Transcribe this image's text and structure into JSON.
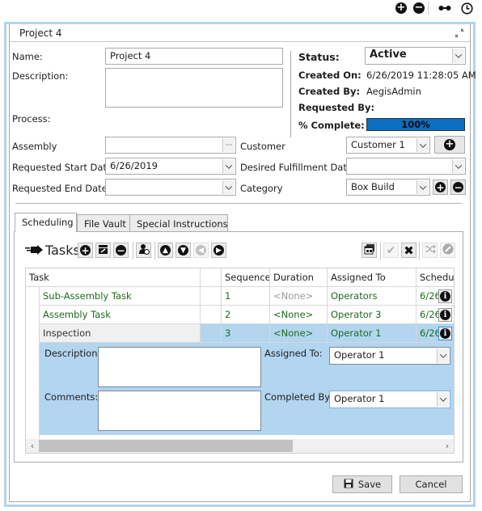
{
  "top_toolbar": {
    "icons": [
      "add-icon",
      "remove-icon",
      "link-icon",
      "clock-icon"
    ]
  },
  "window": {
    "title": "Project 4"
  },
  "form": {
    "name_label": "Name:",
    "name_value": "Project 4",
    "description_label": "Description:",
    "description_value": "",
    "process_label": "Process:",
    "assembly_label": "Assembly",
    "assembly_value": "",
    "requested_start_label": "Requested Start Date",
    "requested_start_value": "6/26/2019",
    "requested_end_label": "Requested End Date",
    "requested_end_value": "",
    "customer_label": "Customer",
    "customer_value": "Customer 1",
    "desired_fulfillment_label": "Desired Fulfillment Date",
    "desired_fulfillment_value": "",
    "category_label": "Category",
    "category_value": "Box Build"
  },
  "status_panel": {
    "status_label": "Status:",
    "status_value": "Active",
    "created_on_label": "Created On:",
    "created_on_value": "6/26/2019 11:28:05 AM",
    "created_by_label": "Created By:",
    "created_by_value": "AegisAdmin",
    "requested_by_label": "Requested By:",
    "requested_by_value": "",
    "percent_complete_label": "% Complete:",
    "percent_complete_value": 100,
    "percent_complete_text": "100%",
    "progress_color": "#0a6fc2"
  },
  "tabs": [
    {
      "label": "Scheduling",
      "active": true
    },
    {
      "label": "File Vault",
      "active": false
    },
    {
      "label": "Special Instructions",
      "active": false
    }
  ],
  "tasks_toolbar": {
    "title": "Tasks"
  },
  "grid": {
    "columns": [
      "Task",
      "",
      "Sequence",
      "Duration",
      "Assigned To",
      "Schedul"
    ],
    "rows": [
      {
        "task": "Sub-Assembly Task",
        "sequence": "1",
        "duration": "<None>",
        "assigned_to": "Operators",
        "scheduled": "6/26",
        "selected": false
      },
      {
        "task": "Assembly Task",
        "sequence": "2",
        "duration": "<None>",
        "assigned_to": "Operator 3",
        "scheduled": "6/26",
        "selected": false
      },
      {
        "task": "Inspection",
        "sequence": "3",
        "duration": "<None>",
        "assigned_to": "Operator 1",
        "scheduled": "6/26",
        "selected": true
      }
    ],
    "selection_color": "#b2d5f0"
  },
  "row_detail": {
    "description_label": "Description:",
    "description_value": "",
    "comments_label": "Comments::",
    "comments_value": "",
    "assigned_to_label": "Assigned To:",
    "assigned_to_value": "Operator 1",
    "completed_by_label": "Completed By:",
    "completed_by_value": "Operator 1"
  },
  "footer": {
    "save_label": "Save",
    "cancel_label": "Cancel"
  }
}
